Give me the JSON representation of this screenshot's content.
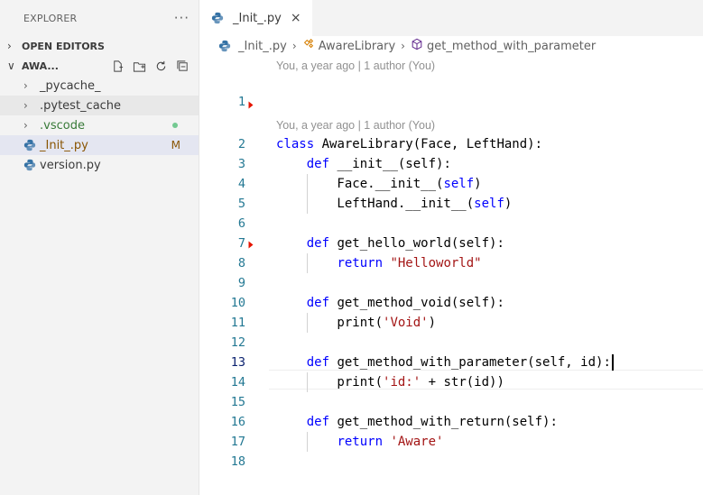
{
  "sidebar": {
    "header": "EXPLORER",
    "more_label": "···",
    "open_editors": "OPEN EDITORS",
    "folder": "AWA...",
    "items": [
      {
        "label": "_pycache_",
        "kind": "folder"
      },
      {
        "label": ".pytest_cache",
        "kind": "folder"
      },
      {
        "label": ".vscode",
        "kind": "folder",
        "status": "dot"
      },
      {
        "label": "_Init_.py",
        "kind": "file",
        "status": "M"
      },
      {
        "label": "version.py",
        "kind": "file"
      }
    ]
  },
  "editor": {
    "tab": {
      "label": "_Init_.py",
      "close": "×"
    },
    "breadcrumb": {
      "file": "_Init_.py",
      "class": "AwareLibrary",
      "method": "get_method_with_parameter"
    },
    "codelens_top": "You, a year ago | 1 author (You)",
    "codelens_class": "You, a year ago | 1 author (You)"
  },
  "code_lines": [
    {
      "n": "1",
      "text": ""
    },
    {
      "n": "2",
      "text": "class AwareLibrary(Face, LeftHand):"
    },
    {
      "n": "3",
      "text": "    def __init__(self):"
    },
    {
      "n": "4",
      "text": "        Face.__init__(self)"
    },
    {
      "n": "5",
      "text": "        LeftHand.__init__(self)"
    },
    {
      "n": "6",
      "text": ""
    },
    {
      "n": "7",
      "text": "    def get_hello_world(self):"
    },
    {
      "n": "8",
      "text": "        return \"Helloworld\""
    },
    {
      "n": "9",
      "text": ""
    },
    {
      "n": "10",
      "text": "    def get_method_void(self):"
    },
    {
      "n": "11",
      "text": "        print('Void')"
    },
    {
      "n": "12",
      "text": ""
    },
    {
      "n": "13",
      "text": "    def get_method_with_parameter(self, id):"
    },
    {
      "n": "14",
      "text": "        print('id:' + str(id))"
    },
    {
      "n": "15",
      "text": ""
    },
    {
      "n": "16",
      "text": "    def get_method_with_return(self):"
    },
    {
      "n": "17",
      "text": "        return 'Aware'"
    },
    {
      "n": "18",
      "text": ""
    }
  ],
  "colors": {
    "keyword": "#0000ff",
    "string": "#a31515",
    "line_number": "#237893",
    "modified": "#895503",
    "untracked_dot": "#73c991"
  }
}
